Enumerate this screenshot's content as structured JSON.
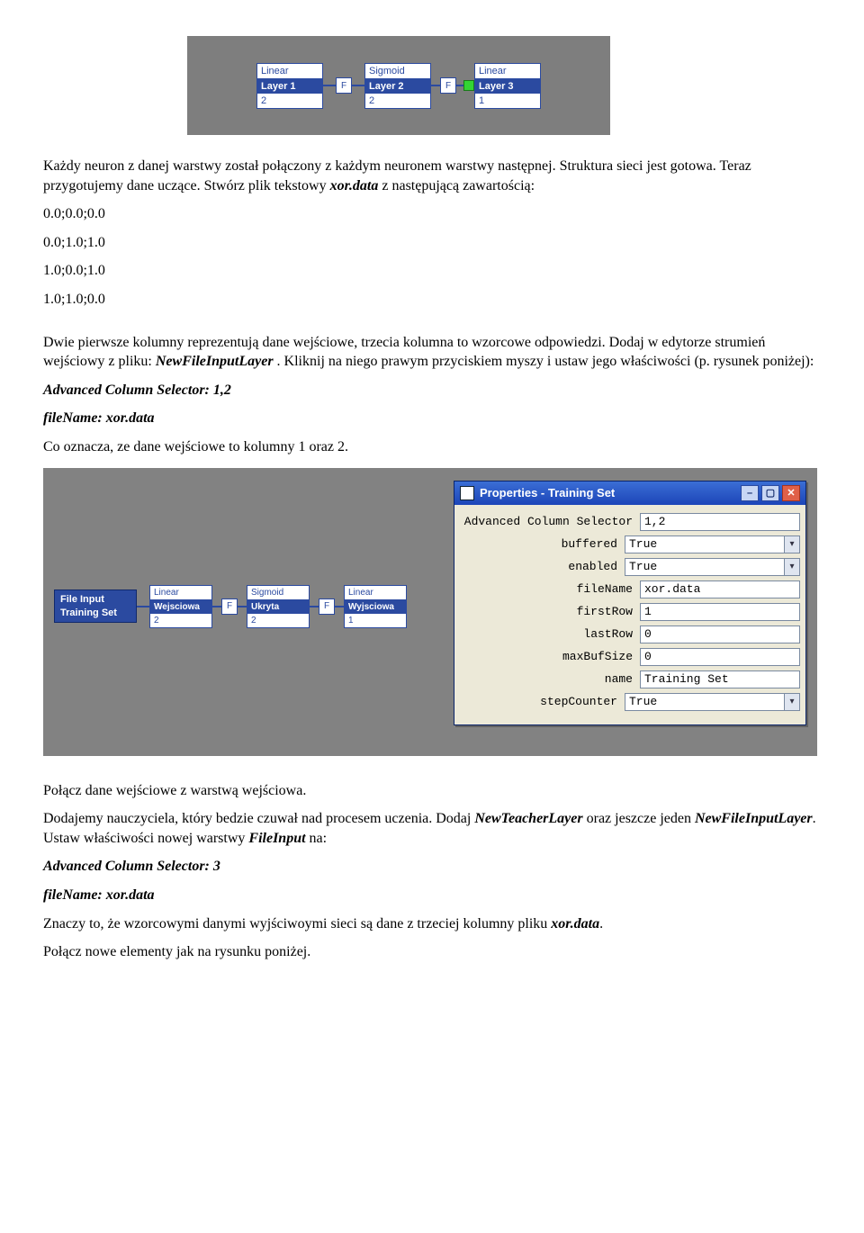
{
  "fig1": {
    "layers": [
      {
        "type": "Linear",
        "name": "Layer 1",
        "count": "2"
      },
      {
        "type": "Sigmoid",
        "name": "Layer 2",
        "count": "2"
      },
      {
        "type": "Linear",
        "name": "Layer 3",
        "count": "1"
      }
    ],
    "fLabel": "F"
  },
  "para1": "Każdy neuron z danej warstwy został połączony z każdym neuronem warstwy następnej. Struktura sieci jest gotowa. Teraz przygotujemy dane uczące. Stwórz plik tekstowy ",
  "para1_file": "xor.data",
  "para1_tail": " z następującą zawartością:",
  "data_lines": [
    "0.0;0.0;0.0",
    "0.0;1.0;1.0",
    "1.0;0.0;1.0",
    "1.0;1.0;0.0"
  ],
  "para2_a": "Dwie pierwsze kolumny reprezentują dane wejściowe, trzecia kolumna to wzorcowe odpowiedzi. Dodaj w edytorze strumień wejściowy z pliku: ",
  "para2_b": "NewFileInputLayer",
  "para2_c": " . Kliknij na niego prawym przyciskiem myszy i ustaw jego właściwości (p. rysunek poniżej):",
  "settings1_line1": "Advanced Column Selector: 1,2",
  "settings1_line2": "fileName: xor.data",
  "para3": "Co oznacza, ze dane wejściowe to kolumny 1 oraz 2.",
  "fig2": {
    "fileInput": {
      "l1": "File Input",
      "l2": "Training Set"
    },
    "layers": [
      {
        "type": "Linear",
        "name": "Wejsciowa",
        "count": "2"
      },
      {
        "type": "Sigmoid",
        "name": "Ukryta",
        "count": "2"
      },
      {
        "type": "Linear",
        "name": "Wyjsciowa",
        "count": "1"
      }
    ],
    "fLabel": "F",
    "props": {
      "title": "Properties - Training Set",
      "rows": [
        {
          "label": "Advanced Column Selector",
          "value": "1,2",
          "select": false
        },
        {
          "label": "buffered",
          "value": "True",
          "select": true
        },
        {
          "label": "enabled",
          "value": "True",
          "select": true
        },
        {
          "label": "fileName",
          "value": "xor.data",
          "select": false
        },
        {
          "label": "firstRow",
          "value": "1",
          "select": false
        },
        {
          "label": "lastRow",
          "value": "0",
          "select": false
        },
        {
          "label": "maxBufSize",
          "value": "0",
          "select": false
        },
        {
          "label": "name",
          "value": "Training Set",
          "select": false
        },
        {
          "label": "stepCounter",
          "value": "True",
          "select": true
        }
      ]
    }
  },
  "para4": "Połącz dane wejściowe z warstwą wejściowa.",
  "para5_a": "Dodajemy nauczyciela, który bedzie czuwał nad procesem uczenia. Dodaj ",
  "para5_b": "NewTeacherLayer",
  "para5_c": " oraz jeszcze jeden  ",
  "para5_d": "NewFileInputLayer",
  "para5_e": ". Ustaw właściwości nowej warstwy ",
  "para5_f": "FileInput",
  "para5_g": " na:",
  "settings2_line1": "Advanced Column Selector: 3",
  "settings2_line2": "fileName: xor.data",
  "para6_a": "Znaczy to, że wzorcowymi danymi wyjściwoymi sieci są dane z trzeciej kolumny pliku ",
  "para6_b": "xor.data",
  "para6_c": ".",
  "para7": "Połącz nowe elementy jak na rysunku poniżej."
}
